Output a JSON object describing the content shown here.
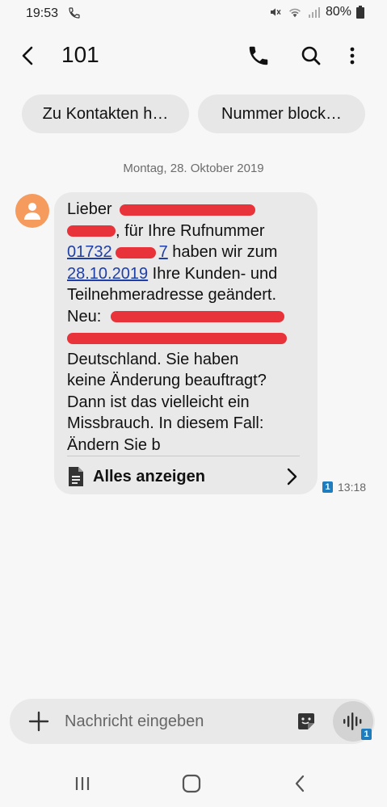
{
  "status_bar": {
    "time": "19:53",
    "battery": "80%"
  },
  "header": {
    "title": "101"
  },
  "actions": {
    "add_contact": "Zu Kontakten h…",
    "block_number": "Nummer block…"
  },
  "conversation": {
    "date": "Montag, 28. Oktober 2019",
    "message": {
      "lines": [
        {
          "text": "Lieber",
          "after": ""
        },
        {
          "text": "",
          "after": ", für Ihre Rufnummer"
        },
        {
          "link1": "01732",
          "link2": "7",
          "after": " haben wir zum"
        },
        {
          "link": "28.10.2019",
          "after": " Ihre Kunden- und"
        },
        {
          "text": "Teilnehmeradresse geändert."
        },
        {
          "text": "Neu:"
        },
        {
          "text": ""
        },
        {
          "text": "Deutschland. Sie haben"
        },
        {
          "text": "keine Änderung beauftragt?"
        },
        {
          "text": "Dann ist das vielleicht ein"
        },
        {
          "text": "Missbrauch. In diesem Fall:"
        },
        {
          "text": "Ändern Sie b"
        }
      ],
      "show_all": "Alles anzeigen",
      "sim_slot": "1",
      "time": "13:18"
    }
  },
  "composer": {
    "placeholder": "Nachricht eingeben",
    "sim_slot": "1"
  },
  "icons": {
    "back": "back-arrow-icon",
    "call": "phone-icon",
    "search": "search-icon",
    "more": "more-vert-icon",
    "avatar": "person-icon",
    "document": "document-icon",
    "chevron": "chevron-right-icon",
    "add": "plus-icon",
    "sticker": "sticker-icon",
    "voice": "voice-wave-icon"
  },
  "colors": {
    "avatar": "#f59b5e",
    "link": "#1f3fa8",
    "redaction": "#e8333b",
    "sim_badge": "#1d7dbf"
  }
}
